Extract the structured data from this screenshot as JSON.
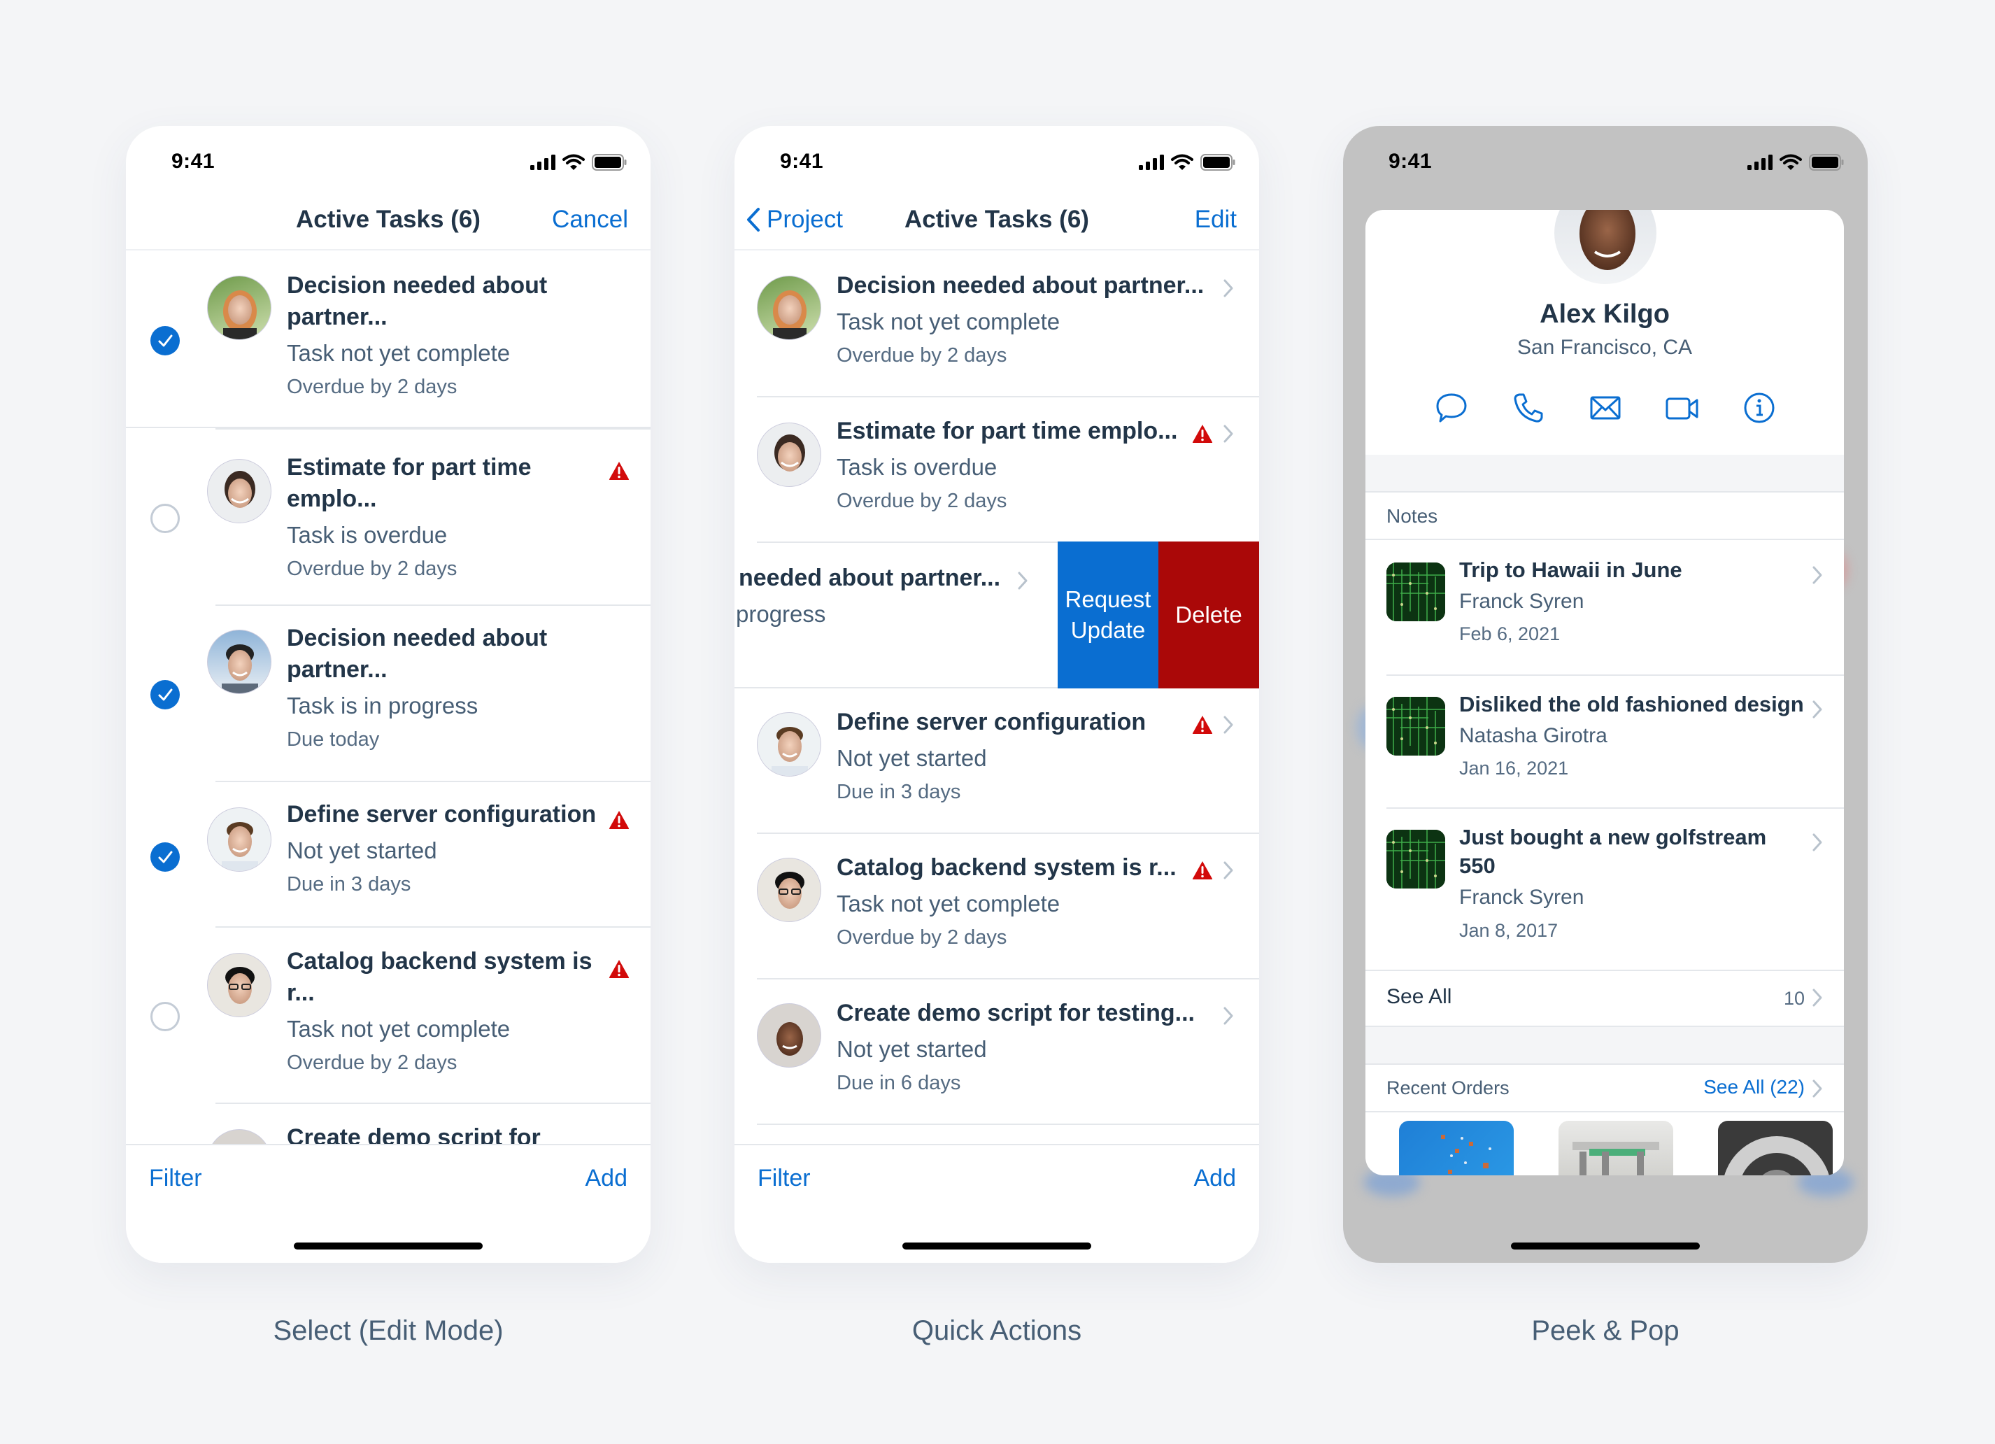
{
  "status_bar": {
    "time": "9:41"
  },
  "panels": {
    "select": {
      "caption": "Select (Edit Mode)",
      "nav": {
        "title": "Active Tasks (6)",
        "right": "Cancel"
      },
      "toolbar": {
        "left": "Filter",
        "right": "Add"
      },
      "rows": [
        {
          "title1": "Decision needed about",
          "title2": "partner...",
          "status": "Task not yet complete",
          "due": "Overdue by 2 days",
          "checked": true,
          "warning": false,
          "avatar": "woman-redhair"
        },
        {
          "title1": "Estimate for part time",
          "title2": "emplo...",
          "status": "Task is overdue",
          "due": "Overdue by 2 days",
          "checked": false,
          "warning": true,
          "avatar": "woman-asian"
        },
        {
          "title1": "Decision needed about",
          "title2": "partner...",
          "status": "Task is in progress",
          "due": "Due today",
          "checked": true,
          "warning": false,
          "avatar": "man-asian-suit"
        },
        {
          "title1": "Define server configuration",
          "title2": "",
          "status": "Not yet started",
          "due": "Due in 3 days",
          "checked": true,
          "warning": true,
          "avatar": "man-smiling"
        },
        {
          "title1": "Catalog backend system is",
          "title2": "r...",
          "status": "Task not yet complete",
          "due": "Overdue by 2 days",
          "checked": false,
          "warning": true,
          "avatar": "man-glasses"
        },
        {
          "title1": "Create demo script for",
          "title2": "",
          "status": "",
          "due": "",
          "checked": false,
          "warning": false,
          "avatar": "man-dark"
        }
      ]
    },
    "quick": {
      "caption": "Quick Actions",
      "nav": {
        "back": "Project",
        "title": "Active Tasks (6)",
        "right": "Edit"
      },
      "toolbar": {
        "left": "Filter",
        "right": "Add"
      },
      "rows": [
        {
          "title": "Decision needed about partner...",
          "status": "Task not yet complete",
          "due": "Overdue by 2 days",
          "warning": false
        },
        {
          "title": "Estimate for part time emplo...",
          "status": "Task is overdue",
          "due": "Overdue by 2 days",
          "warning": true
        },
        {
          "title": "needed about partner...",
          "status": "progress",
          "due": "",
          "warning": false,
          "swiped": true
        },
        {
          "title": "Define server configuration",
          "status": "Not yet started",
          "due": "Due in 3 days",
          "warning": true
        },
        {
          "title": "Catalog backend system is r...",
          "status": "Task not yet complete",
          "due": "Overdue by 2 days",
          "warning": true
        },
        {
          "title": "Create demo script for testing...",
          "status": "Not yet started",
          "due": "Due in 6 days",
          "warning": false
        }
      ],
      "swipe_actions": {
        "request_update": "Request Update",
        "delete": "Delete"
      }
    },
    "peek": {
      "caption": "Peek & Pop",
      "profile": {
        "name": "Alex Kilgo",
        "location": "San Francisco, CA"
      },
      "actions": [
        "message-icon",
        "phone-icon",
        "email-icon",
        "video-icon",
        "info-icon"
      ],
      "notes_header": "Notes",
      "notes": [
        {
          "title1": "Trip to Hawaii in June",
          "title2": "",
          "author": "Franck Syren",
          "date": "Feb 6, 2021"
        },
        {
          "title1": "Disliked the old fashioned design",
          "title2": "",
          "author": "Natasha Girotra",
          "date": "Jan 16, 2021"
        },
        {
          "title1": "Just bought a new golfstream",
          "title2": "550",
          "author": "Franck Syren",
          "date": "Jan 8, 2017"
        }
      ],
      "see_all": {
        "label": "See All",
        "count": "10"
      },
      "recent_orders": {
        "label": "Recent Orders",
        "link": "See All (22)"
      }
    }
  },
  "colors": {
    "accent": "#0a6ed1",
    "negative": "#aa0808",
    "warning": "#d20a0a",
    "title": "#223548",
    "secondary": "#475e75"
  }
}
